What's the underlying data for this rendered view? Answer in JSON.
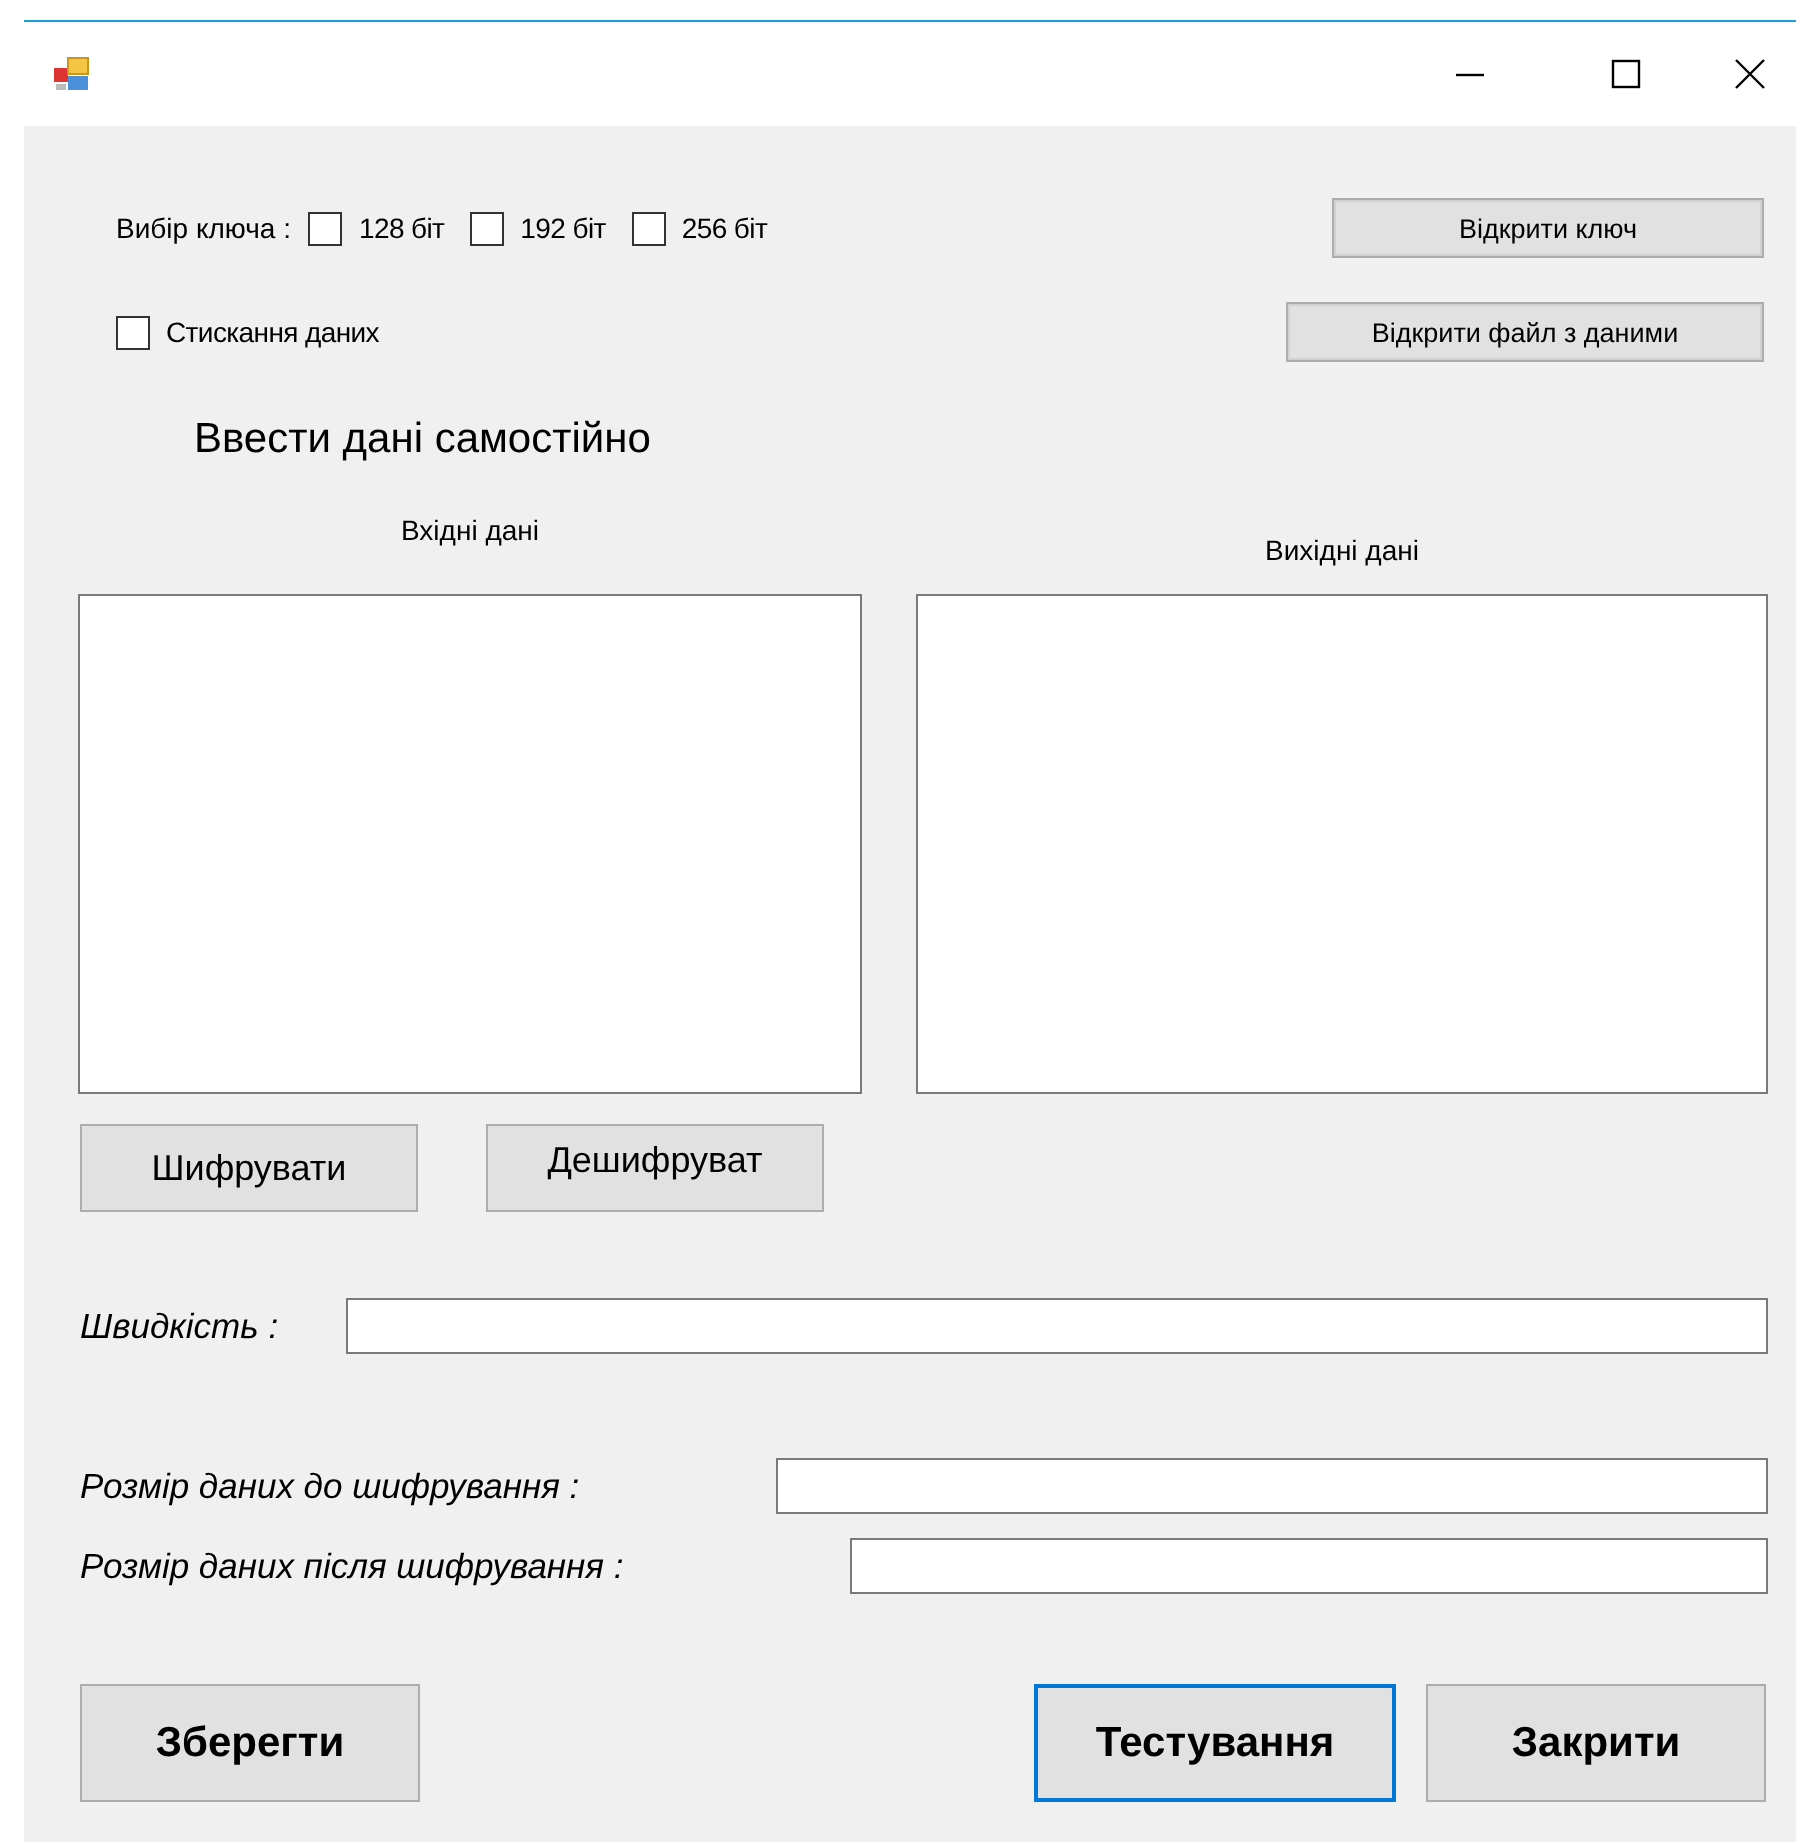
{
  "key_selection": {
    "label": "Вибір ключа :",
    "options": [
      {
        "label": "128 біт",
        "checked": false
      },
      {
        "label": "192 біт",
        "checked": false
      },
      {
        "label": "256 біт",
        "checked": false
      }
    ]
  },
  "compression": {
    "label": "Стискання даних",
    "checked": false
  },
  "top_buttons": [
    {
      "label": "Відкрити ключ"
    },
    {
      "label": "Відкрити файл з даними"
    }
  ],
  "heading": "Ввести дані самостійно",
  "panels": [
    {
      "label": "Вхідні дані"
    },
    {
      "label": "Вихідні дані"
    }
  ],
  "action_buttons": [
    {
      "label": "Шифрувати"
    },
    {
      "label": "Дешифруват"
    }
  ],
  "metrics": [
    {
      "label": "Швидкість :"
    },
    {
      "label": "Розмір даних до шифрування :"
    },
    {
      "label": "Розмір даних після шифрування :"
    }
  ],
  "bottom_buttons": [
    {
      "label": "Зберегти",
      "focused": false
    },
    {
      "label": "Тестування",
      "focused": true
    },
    {
      "label": "Закрити",
      "focused": false
    }
  ]
}
